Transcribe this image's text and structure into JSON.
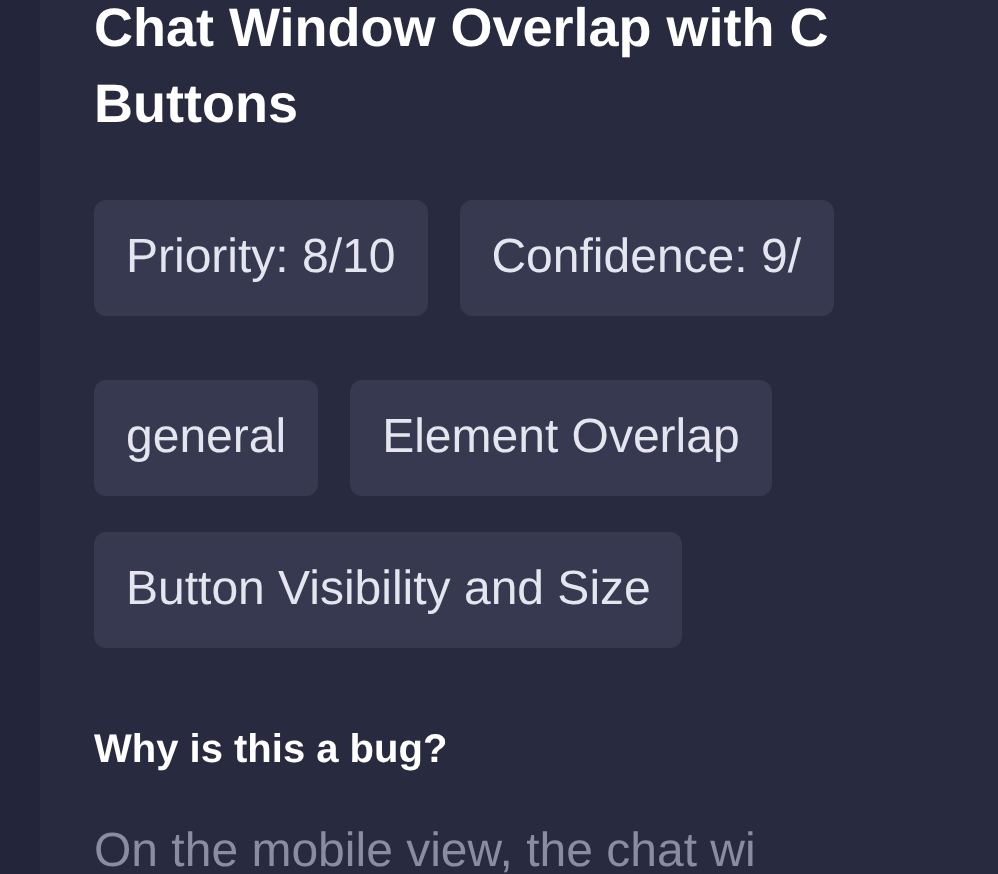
{
  "title": {
    "lines": [
      "Chat Window Overlap with C",
      "Buttons"
    ]
  },
  "scores": [
    "Priority: 8/10",
    "Confidence: 9/"
  ],
  "tags": [
    "general",
    "Element Overlap",
    "Button Visibility and Size"
  ],
  "explanation": {
    "heading": "Why is this a bug?",
    "text": "On the mobile view, the chat wi"
  }
}
